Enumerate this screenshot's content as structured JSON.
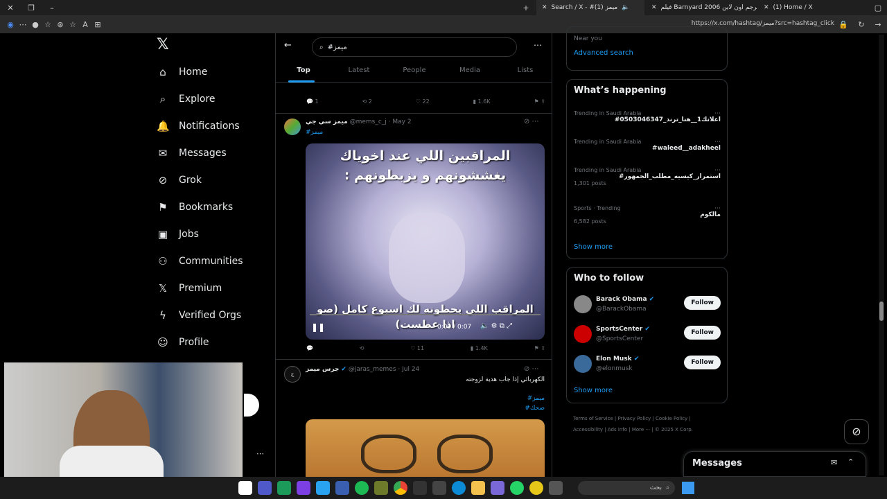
{
  "browser": {
    "tabs": [
      {
        "title": "Search / X - #ميمز (1)"
      },
      {
        "title": "فيلم Barnyard 2006 مترجم اون لاين"
      },
      {
        "title": "(1) Home / X"
      }
    ],
    "url": "https://x.com/hashtag/ميمز?src=hashtag_click"
  },
  "nav": {
    "items": [
      {
        "label": "Home",
        "icon": "⌂"
      },
      {
        "label": "Explore",
        "icon": "⌕"
      },
      {
        "label": "Notifications",
        "icon": "🔔"
      },
      {
        "label": "Messages",
        "icon": "✉"
      },
      {
        "label": "Grok",
        "icon": "⊘"
      },
      {
        "label": "Bookmarks",
        "icon": "⚑"
      },
      {
        "label": "Jobs",
        "icon": "▣"
      },
      {
        "label": "Communities",
        "icon": "⚇"
      },
      {
        "label": "Premium",
        "icon": "𝕏"
      },
      {
        "label": "Verified Orgs",
        "icon": "ϟ"
      },
      {
        "label": "Profile",
        "icon": "☺"
      }
    ]
  },
  "search": {
    "query": "#ميمز"
  },
  "tabs": [
    "Top",
    "Latest",
    "People",
    "Media",
    "Lists"
  ],
  "post0": {
    "replies": "1",
    "reposts": "2",
    "likes": "22",
    "views": "1.6K"
  },
  "post1": {
    "name": "ميمز سي جي",
    "handle": "@mems_c_j · May 2",
    "hashtag": "#ميمز",
    "caption_top": "المراقبين اللي عند اخوياك يغششونهم و يزبطونهم :",
    "caption_bottom": "المراقب اللي يحطونه لك اسبوع كامل (صو اذا عطست)",
    "time": "0:00 / 0:07",
    "replies": "",
    "reposts": "",
    "likes": "11",
    "views": "1.4K"
  },
  "post2": {
    "name": "جرس ميمز",
    "handle": "@jaras_memes · Jul 24",
    "text": "الكهربائي إذا جاب هدية لزوجته",
    "tag1": "#ميمز",
    "tag2": "#ضحك"
  },
  "right": {
    "near": "Near you",
    "advanced": "Advanced search",
    "happening_title": "What’s happening",
    "trends": [
      {
        "sub": "Trending in Saudi Arabia",
        "title": "#اعلانك1__هنا_ترند_0503046347",
        "count": ""
      },
      {
        "sub": "Trending in Saudi Arabia",
        "title": "#waleed__adakheel",
        "count": ""
      },
      {
        "sub": "Trending in Saudi Arabia",
        "title": "#استمرار_كيسيه_مطلب_الجمهور",
        "count": "1,301 posts"
      },
      {
        "sub": "Sports · Trending",
        "title": "مالكوم",
        "count": "6,582 posts"
      }
    ],
    "show_more": "Show more",
    "wtf_title": "Who to follow",
    "follows": [
      {
        "name": "Barack Obama",
        "handle": "@BarackObama"
      },
      {
        "name": "SportsCenter",
        "handle": "@SportsCenter"
      },
      {
        "name": "Elon Musk",
        "handle": "@elonmusk"
      }
    ],
    "follow_label": "Follow",
    "footer": [
      "Terms of Service",
      "Privacy Policy",
      "Cookie Policy",
      "Accessibility",
      "Ads info",
      "More ···",
      "© 2025 X Corp."
    ]
  },
  "messages": {
    "title": "Messages"
  },
  "taskbar": {
    "search": "بحث"
  },
  "webcam": {
    "label": "logi"
  }
}
